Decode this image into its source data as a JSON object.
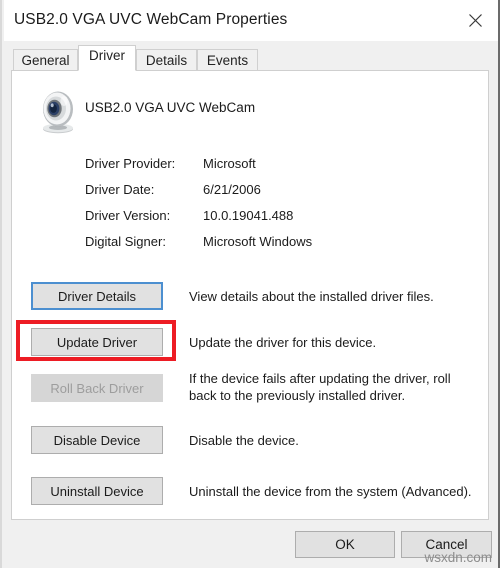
{
  "window": {
    "title": "USB2.0 VGA UVC WebCam Properties",
    "close_label": "✕"
  },
  "tabs": [
    {
      "label": "General",
      "active": false
    },
    {
      "label": "Driver",
      "active": true
    },
    {
      "label": "Details",
      "active": false
    },
    {
      "label": "Events",
      "active": false
    }
  ],
  "device": {
    "name": "USB2.0 VGA UVC WebCam",
    "icon": "webcam-icon"
  },
  "info_rows": [
    {
      "label": "Driver Provider:",
      "value": "Microsoft"
    },
    {
      "label": "Driver Date:",
      "value": "6/21/2006"
    },
    {
      "label": "Driver Version:",
      "value": "10.0.19041.488"
    },
    {
      "label": "Digital Signer:",
      "value": "Microsoft Windows"
    }
  ],
  "actions": [
    {
      "label": "Driver Details",
      "description": "View details about the installed driver files.",
      "state": "focused"
    },
    {
      "label": "Update Driver",
      "description": "Update the driver for this device.",
      "state": "highlighted"
    },
    {
      "label": "Roll Back Driver",
      "description": "If the device fails after updating the driver, roll back to the previously installed driver.",
      "state": "disabled"
    },
    {
      "label": "Disable Device",
      "description": "Disable the device.",
      "state": "normal"
    },
    {
      "label": "Uninstall Device",
      "description": "Uninstall the device from the system (Advanced).",
      "state": "normal"
    }
  ],
  "footer": {
    "ok_label": "OK",
    "cancel_label": "Cancel"
  },
  "watermark": "wsxdn.com",
  "colors": {
    "highlight_red": "#ed1c24",
    "focus_blue": "#4c8fd0",
    "dialog_background": "#f0f0f0",
    "panel_background": "#ffffff",
    "button_face": "#e1e1e1"
  }
}
